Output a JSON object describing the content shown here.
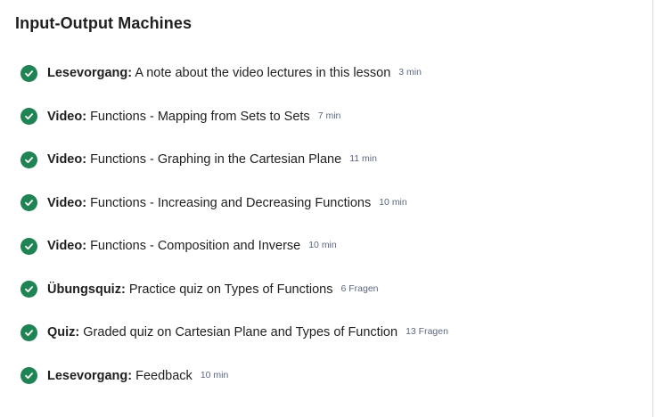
{
  "module": {
    "title": "Input-Output Machines"
  },
  "colors": {
    "completed_green": "#1f8354",
    "meta_text": "#5b6780"
  },
  "items": [
    {
      "icon": "check-circle-icon",
      "type": "Lesevorgang:",
      "title": " A note about the video lectures in this lesson",
      "meta": "3 min"
    },
    {
      "icon": "check-circle-icon",
      "type": "Video:",
      "title": " Functions - Mapping from Sets to Sets",
      "meta": "7 min"
    },
    {
      "icon": "check-circle-icon",
      "type": "Video:",
      "title": " Functions - Graphing in the Cartesian Plane",
      "meta": "11 min"
    },
    {
      "icon": "check-circle-icon",
      "type": "Video:",
      "title": " Functions - Increasing and Decreasing Functions",
      "meta": "10 min"
    },
    {
      "icon": "check-circle-icon",
      "type": "Video:",
      "title": " Functions - Composition and Inverse",
      "meta": "10 min"
    },
    {
      "icon": "check-circle-icon",
      "type": "Übungsquiz:",
      "title": " Practice quiz on Types of Functions",
      "meta": "6 Fragen"
    },
    {
      "icon": "check-circle-icon",
      "type": "Quiz:",
      "title": " Graded quiz on Cartesian Plane and Types of Function",
      "meta": "13 Fragen"
    },
    {
      "icon": "check-circle-icon",
      "type": "Lesevorgang:",
      "title": " Feedback",
      "meta": "10 min"
    }
  ]
}
